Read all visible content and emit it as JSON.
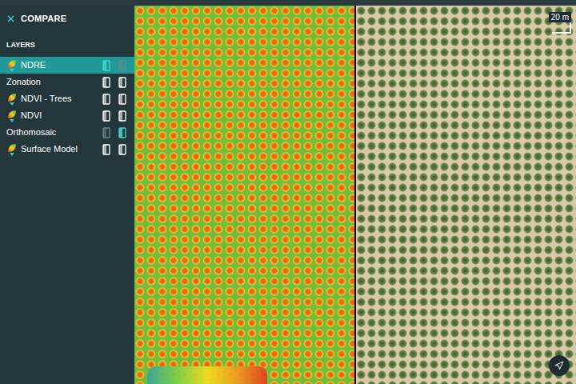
{
  "header": {
    "title": "COMPARE"
  },
  "section": "LAYERS",
  "layers": [
    {
      "name": "NDRE",
      "kind": "index",
      "selected": true,
      "left_shown": true,
      "left_disabled": false,
      "right_shown": false,
      "right_disabled": true
    },
    {
      "name": "Zonation",
      "kind": "plain",
      "selected": false,
      "left_shown": false,
      "left_disabled": false,
      "right_shown": false,
      "right_disabled": false
    },
    {
      "name": "NDVI - Trees",
      "kind": "index",
      "selected": false,
      "left_shown": false,
      "left_disabled": false,
      "right_shown": false,
      "right_disabled": false
    },
    {
      "name": "NDVI",
      "kind": "index",
      "selected": false,
      "left_shown": false,
      "left_disabled": false,
      "right_shown": false,
      "right_disabled": false
    },
    {
      "name": "Orthomosaic",
      "kind": "plain",
      "selected": false,
      "left_shown": false,
      "left_disabled": true,
      "right_shown": true,
      "right_disabled": false
    },
    {
      "name": "Surface Model",
      "kind": "index",
      "selected": false,
      "left_shown": false,
      "left_disabled": false,
      "right_shown": false,
      "right_disabled": false
    }
  ],
  "map": {
    "scale": "20 m"
  }
}
